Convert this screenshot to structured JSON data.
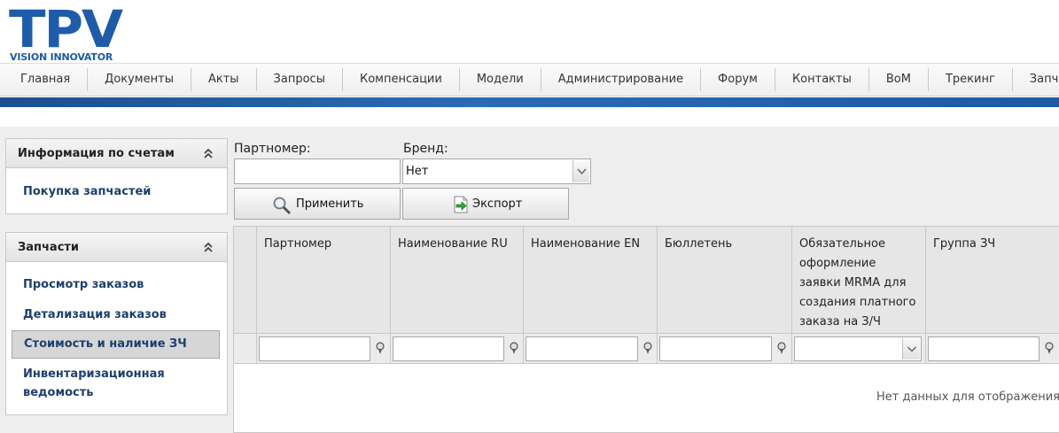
{
  "brand": {
    "logo_text": "TPV",
    "tagline": "VISION INNOVATOR"
  },
  "nav": [
    "Главная",
    "Документы",
    "Акты",
    "Запросы",
    "Компенсации",
    "Модели",
    "Администрирование",
    "Форум",
    "Контакты",
    "BoM",
    "Трекинг",
    "Запчасти"
  ],
  "sidebar": {
    "accounts": {
      "title": "Информация по счетам",
      "items": [
        "Покупка запчастей"
      ]
    },
    "parts": {
      "title": "Запчасти",
      "items": [
        "Просмотр заказов",
        "Детализация заказов",
        "Стоимость и наличие ЗЧ",
        "Инвентаризационная ведомость"
      ],
      "active_index": 2
    }
  },
  "filters": {
    "partnumber_label": "Партномер:",
    "partnumber_value": "",
    "brand_label": "Бренд:",
    "brand_value": "Нет",
    "apply_label": "Применить",
    "export_label": "Экспорт"
  },
  "grid": {
    "columns": [
      "Партномер",
      "Наименование RU",
      "Наименование EN",
      "Бюллетень",
      "Обязательное оформление заявки MRMA для создания платного заказа на З/Ч",
      "Группа ЗЧ"
    ],
    "empty_text": "Нет данных для отображения"
  },
  "colors": {
    "brand_blue": "#1d5caa",
    "link_blue": "#1c3f6f",
    "band_blue": "#1b4f93"
  },
  "icons": [
    "collapse-up-icon",
    "search-icon",
    "export-icon",
    "filter-icon",
    "dropdown-arrow-icon"
  ]
}
